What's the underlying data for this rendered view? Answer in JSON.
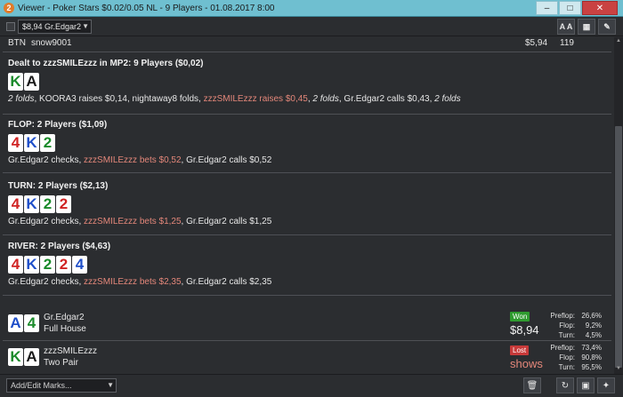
{
  "window": {
    "icon_glyph": "2",
    "title": "Viewer - Poker Stars $0.02/0.05 NL - 9 Players - 01.08.2017 8:00",
    "controls": [
      "minimize-icon",
      "maximize-icon",
      "close-icon"
    ]
  },
  "toolbar": {
    "player_select": "$8,94 Gr.Edgar2",
    "font_button": "A A",
    "grid_icon": "grid-icon",
    "edit_icon": "pencil-icon"
  },
  "hand": {
    "button_row": {
      "position": "BTN",
      "player": "snow9001",
      "stack": "$5,94",
      "bb": "119"
    },
    "preflop": {
      "title": "Dealt to zzzSMILEzzz in MP2: 9 Players ($0,02)",
      "cards": [
        {
          "rank": "K",
          "suit": "club"
        },
        {
          "rank": "A",
          "suit": "spade"
        }
      ],
      "action_1": "2 folds",
      "action_2": ", KOORA3 raises $0,14, nightaway8 folds, ",
      "action_3": "zzzSMILEzzz raises $0,45",
      "action_4": ", ",
      "action_5": "2 folds",
      "action_6": ", Gr.Edgar2 calls $0,43, ",
      "action_7": "2 folds"
    },
    "flop": {
      "title": "FLOP: 2 Players ($1,09)",
      "cards": [
        {
          "rank": "4",
          "suit": "heart"
        },
        {
          "rank": "K",
          "suit": "diam"
        },
        {
          "rank": "2",
          "suit": "club"
        }
      ],
      "action_1": "Gr.Edgar2 checks, ",
      "action_2": "zzzSMILEzzz bets $0,52",
      "action_3": ", Gr.Edgar2 calls $0,52"
    },
    "turn": {
      "title": "TURN: 2 Players ($2,13)",
      "cards": [
        {
          "rank": "4",
          "suit": "heart"
        },
        {
          "rank": "K",
          "suit": "diam"
        },
        {
          "rank": "2",
          "suit": "club"
        },
        {
          "rank": "2",
          "suit": "heart"
        }
      ],
      "action_1": "Gr.Edgar2 checks, ",
      "action_2": "zzzSMILEzzz bets $1,25",
      "action_3": ", Gr.Edgar2 calls $1,25"
    },
    "river": {
      "title": "RIVER: 2 Players ($4,63)",
      "cards": [
        {
          "rank": "4",
          "suit": "heart"
        },
        {
          "rank": "K",
          "suit": "diam"
        },
        {
          "rank": "2",
          "suit": "club"
        },
        {
          "rank": "2",
          "suit": "heart"
        },
        {
          "rank": "4",
          "suit": "diam"
        }
      ],
      "action_1": "Gr.Edgar2 checks, ",
      "action_2": "zzzSMILEzzz bets $2,35",
      "action_3": ", Gr.Edgar2 calls $2,35"
    },
    "showdown": [
      {
        "player": "Gr.Edgar2",
        "hand": "Full House",
        "cards": [
          {
            "rank": "A",
            "suit": "diam"
          },
          {
            "rank": "4",
            "suit": "club"
          }
        ],
        "result": "Won",
        "amount": "$8,94",
        "stats": [
          {
            "label": "Preflop:",
            "value": "26,6%"
          },
          {
            "label": "Flop:",
            "value": "9,2%"
          },
          {
            "label": "Turn:",
            "value": "4,5%"
          }
        ]
      },
      {
        "player": "zzzSMILEzzz",
        "hand": "Two Pair",
        "cards": [
          {
            "rank": "K",
            "suit": "club"
          },
          {
            "rank": "A",
            "suit": "spade"
          }
        ],
        "result": "Lost",
        "amount": "shows",
        "stats": [
          {
            "label": "Preflop:",
            "value": "73,4%"
          },
          {
            "label": "Flop:",
            "value": "90,8%"
          },
          {
            "label": "Turn:",
            "value": "95,5%"
          }
        ]
      }
    ]
  },
  "bottombar": {
    "marks_placeholder": "Add/Edit Marks...",
    "buttons": [
      "trash-icon",
      "replay-icon",
      "save-icon",
      "twitter-icon"
    ]
  },
  "colors": {
    "hero_action": "#e4877a",
    "won": "#2f9b2f",
    "lost": "#c83a3a",
    "titlebar": "#6fbfd0"
  }
}
